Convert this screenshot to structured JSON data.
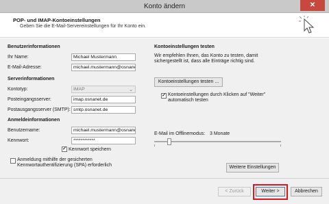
{
  "window": {
    "title": "Konto ändern",
    "close_glyph": "✕"
  },
  "header": {
    "title": "POP- und IMAP-Kontoeinstellungen",
    "subtitle": "Geben Sie die E-Mail-Servereinstellungen für Ihr Konto ein."
  },
  "user_info": {
    "section": "Benutzerinformationen",
    "name_label": "Ihr Name:",
    "name_value": "Michael Mustermann",
    "email_label": "E-Mail-Adresse:",
    "email_value": "michael.mustermann@osnanet.de"
  },
  "server_info": {
    "section": "Serverinformationen",
    "type_label": "Kontotyp:",
    "type_value": "IMAP",
    "incoming_label": "Posteingangsserver:",
    "incoming_value": "imap.osnanet.de",
    "outgoing_label": "Postausgangsserver (SMTP):",
    "outgoing_value": "smtp.osnanet.de"
  },
  "login_info": {
    "section": "Anmeldeinformationen",
    "user_label": "Benutzername:",
    "user_value": "michael.mustermann@osnanet.de",
    "password_label": "Kennwort:",
    "password_value": "************",
    "remember_label": "Kennwort speichern",
    "remember_checked": true,
    "spa_label_1": "Anmeldung mithilfe der gesicherten",
    "spa_label_2": "Kennwortauthentifizierung (SPA) erforderlich",
    "spa_checked": false
  },
  "test": {
    "section": "Kontoeinstellungen testen",
    "desc_1": "Wir empfehlen Ihnen, das Konto zu testen, damit",
    "desc_2": "sichergestellt ist, dass alle Einträge richtig sind.",
    "test_button": "Kontoeinstellungen testen ...",
    "auto_test_1": "Kontoeinstellungen durch Klicken auf \"Weiter\"",
    "auto_test_2": "automatisch testen",
    "auto_test_checked": true
  },
  "offline": {
    "label": "E-Mail im Offlinemodus:",
    "value": "3 Monate",
    "slider_position_fraction": 0.12
  },
  "buttons": {
    "more_settings": "Weitere Einstellungen",
    "back": "< Zurück",
    "next": "Weiter >",
    "cancel": "Abbrechen"
  },
  "colors": {
    "highlight": "#e0141d",
    "close_button": "#c7483d"
  }
}
